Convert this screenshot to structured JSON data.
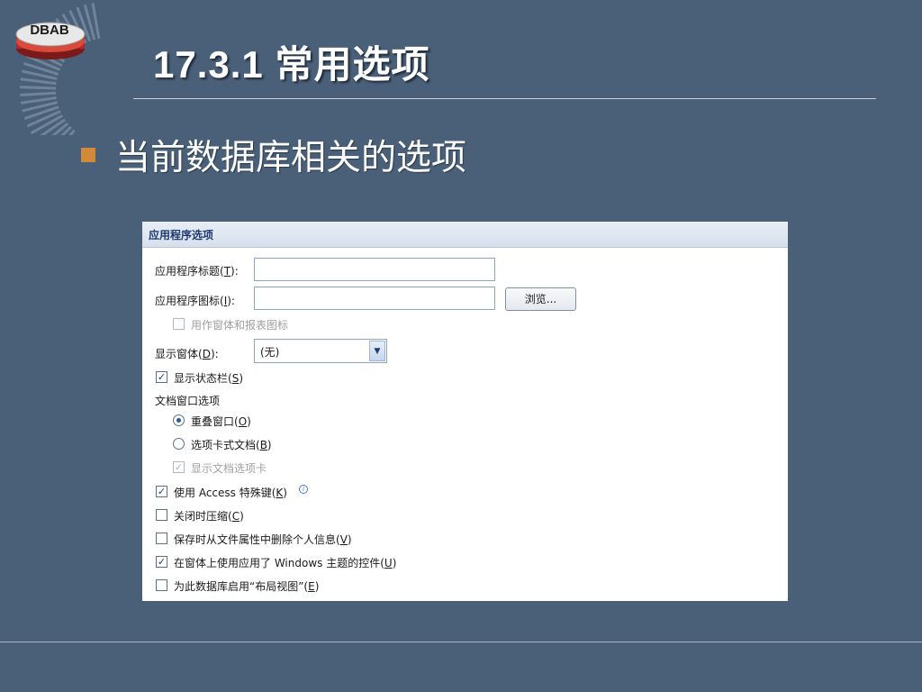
{
  "logo": {
    "text": "DBAB"
  },
  "slide": {
    "title": "17.3.1 常用选项",
    "bullet": "当前数据库相关的选项"
  },
  "colors": {
    "background": "#4a6078",
    "bullet_square": "#d08a3a",
    "dialog_header": "#d6e0ec",
    "dialog_header_text": "#1e3a70"
  },
  "dialog": {
    "section_title": "应用程序选项",
    "app_title": {
      "label": "应用程序标题(",
      "accel": "T",
      "suffix": "):",
      "value": ""
    },
    "app_icon": {
      "label": "应用程序图标(",
      "accel": "I",
      "suffix": "):",
      "value": ""
    },
    "browse_button": "浏览...",
    "use_as_form_icon": {
      "label": "用作窗体和报表图标",
      "checked": false,
      "enabled": false
    },
    "display_form": {
      "label": "显示窗体(",
      "accel": "D",
      "suffix": "):",
      "selected": "(无)",
      "icon": "chevron-down-icon"
    },
    "status_bar": {
      "label": "显示状态栏(",
      "accel": "S",
      "suffix": ")",
      "checked": true
    },
    "doc_window_options": "文档窗口选项",
    "overlapping": {
      "label": "重叠窗口(",
      "accel": "O",
      "suffix": ")",
      "selected": true
    },
    "tabbed": {
      "label": "选项卡式文档(",
      "accel": "B",
      "suffix": ")",
      "selected": false
    },
    "show_doc_tabs": {
      "label": "显示文档选项卡",
      "checked": true,
      "enabled": false
    },
    "access_special_keys": {
      "label": "使用 Access 特殊键(",
      "accel": "K",
      "suffix": ")",
      "checked": true,
      "icon": "info-icon"
    },
    "compact_on_close": {
      "label": "关闭时压缩(",
      "accel": "C",
      "suffix": ")",
      "checked": false
    },
    "remove_personal_info": {
      "label": "保存时从文件属性中删除个人信息(",
      "accel": "V",
      "suffix": ")",
      "checked": false
    },
    "windows_themed_controls": {
      "label": "在窗体上使用应用了 Windows 主题的控件(",
      "accel": "U",
      "suffix": ")",
      "checked": true
    },
    "enable_layout_view": {
      "label": "为此数据库启用“布局视图”(",
      "accel": "E",
      "suffix": ")",
      "checked": false
    }
  }
}
